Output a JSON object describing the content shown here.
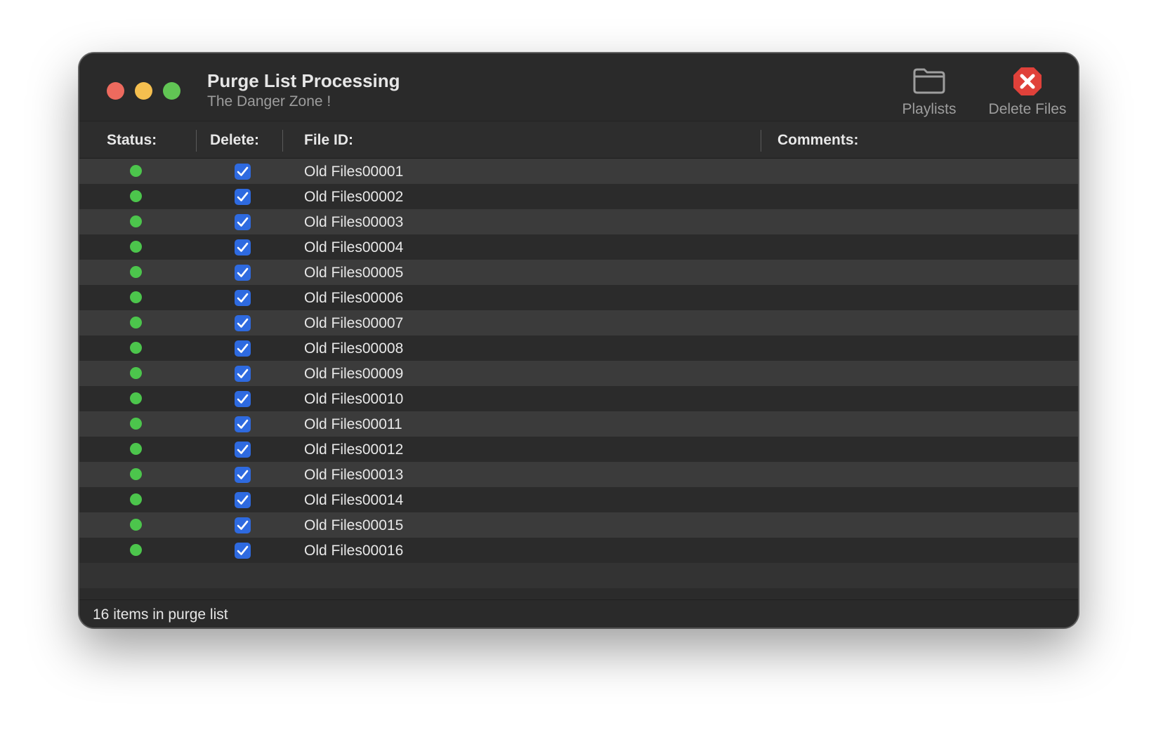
{
  "window": {
    "title": "Purge List Processing",
    "subtitle": "The Danger Zone !"
  },
  "toolbar": {
    "playlists": {
      "label": "Playlists",
      "icon": "folder-icon"
    },
    "delete_files": {
      "label": "Delete Files",
      "icon": "delete-x-icon",
      "color": "#e0413a"
    }
  },
  "table": {
    "columns": {
      "status": "Status:",
      "delete": "Delete:",
      "file_id": "File ID:",
      "comments": "Comments:"
    },
    "status_color": "#4cc54c",
    "checkbox_color": "#2e6ae0",
    "rows": [
      {
        "status": "ok",
        "delete": true,
        "file_id": "Old Files00001",
        "comment": ""
      },
      {
        "status": "ok",
        "delete": true,
        "file_id": "Old Files00002",
        "comment": ""
      },
      {
        "status": "ok",
        "delete": true,
        "file_id": "Old Files00003",
        "comment": ""
      },
      {
        "status": "ok",
        "delete": true,
        "file_id": "Old Files00004",
        "comment": ""
      },
      {
        "status": "ok",
        "delete": true,
        "file_id": "Old Files00005",
        "comment": ""
      },
      {
        "status": "ok",
        "delete": true,
        "file_id": "Old Files00006",
        "comment": ""
      },
      {
        "status": "ok",
        "delete": true,
        "file_id": "Old Files00007",
        "comment": ""
      },
      {
        "status": "ok",
        "delete": true,
        "file_id": "Old Files00008",
        "comment": ""
      },
      {
        "status": "ok",
        "delete": true,
        "file_id": "Old Files00009",
        "comment": ""
      },
      {
        "status": "ok",
        "delete": true,
        "file_id": "Old Files00010",
        "comment": ""
      },
      {
        "status": "ok",
        "delete": true,
        "file_id": "Old Files00011",
        "comment": ""
      },
      {
        "status": "ok",
        "delete": true,
        "file_id": "Old Files00012",
        "comment": ""
      },
      {
        "status": "ok",
        "delete": true,
        "file_id": "Old Files00013",
        "comment": ""
      },
      {
        "status": "ok",
        "delete": true,
        "file_id": "Old Files00014",
        "comment": ""
      },
      {
        "status": "ok",
        "delete": true,
        "file_id": "Old Files00015",
        "comment": ""
      },
      {
        "status": "ok",
        "delete": true,
        "file_id": "Old Files00016",
        "comment": ""
      }
    ]
  },
  "statusbar": {
    "text": "16 items in purge list"
  }
}
